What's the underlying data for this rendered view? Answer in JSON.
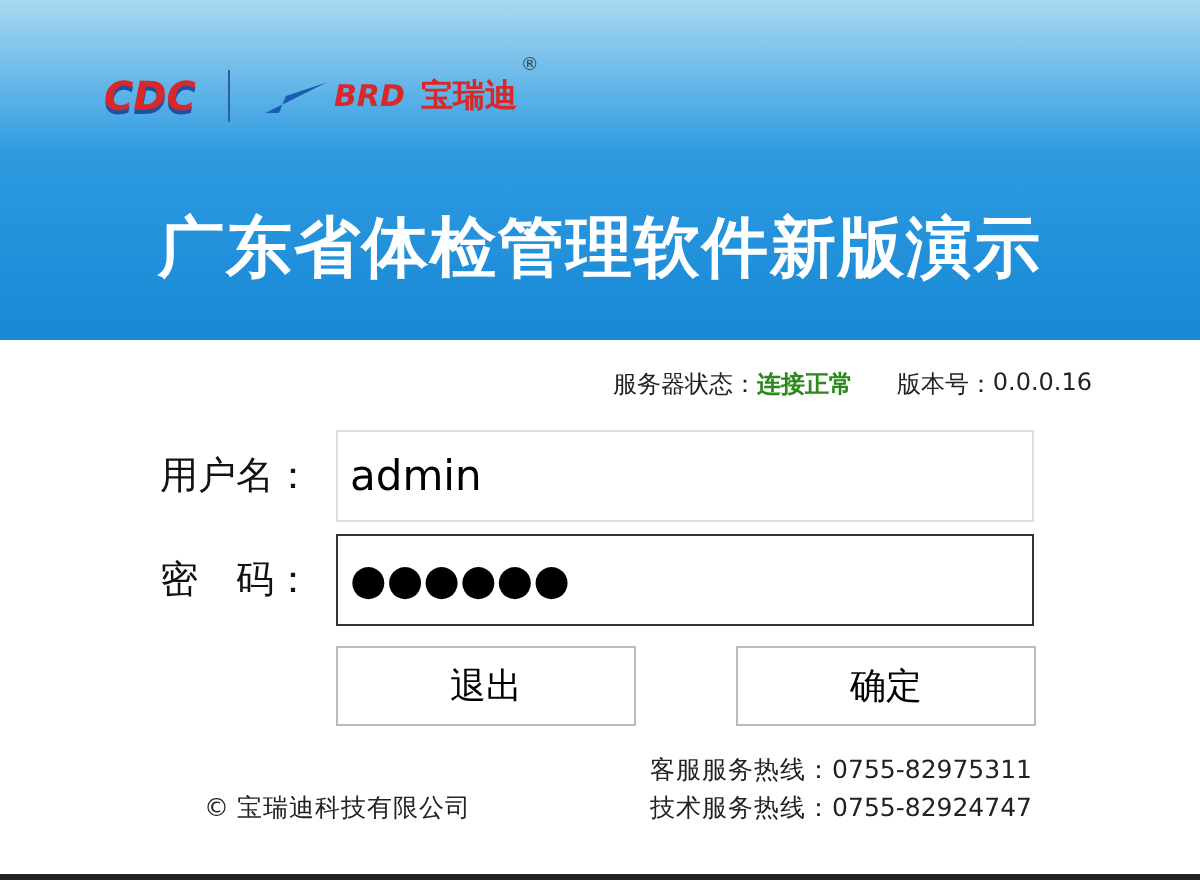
{
  "header": {
    "logo_left": "CDC",
    "logo_right": "BRD",
    "brand": "宝瑞迪",
    "registered": "®",
    "title": "广东省体检管理软件新版演示"
  },
  "status": {
    "label": "服务器状态：",
    "value": "连接正常",
    "version_label": "版本号：",
    "version": "0.0.0.16"
  },
  "fields": [
    {
      "label": "用户名：",
      "value": "admin",
      "focused": false
    },
    {
      "label": "密　码：",
      "value": "●●●●●●",
      "focused": true
    }
  ],
  "buttons": [
    "退出",
    "确定"
  ],
  "footer": {
    "copyright": "© 宝瑞迪科技有限公司",
    "hotlines": [
      "客服服务热线：0755-82975311",
      "技术服务热线：0755-82924747"
    ]
  }
}
